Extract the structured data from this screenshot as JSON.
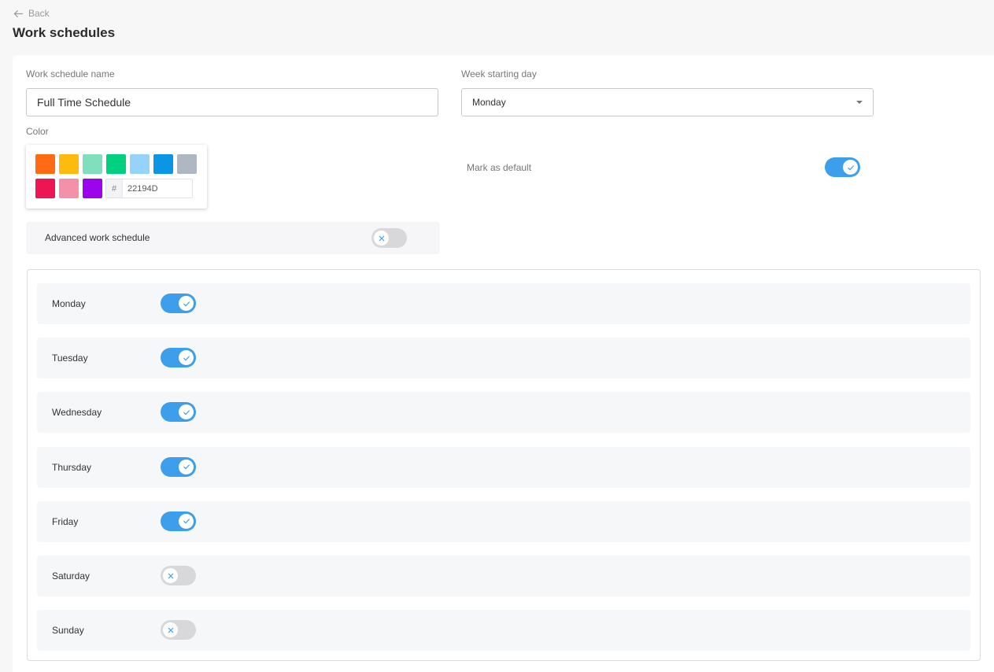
{
  "nav": {
    "back_label": "Back"
  },
  "page": {
    "title": "Work schedules"
  },
  "form": {
    "name_label": "Work schedule name",
    "name_value": "Full Time Schedule",
    "week_start_label": "Week starting day",
    "week_start_value": "Monday",
    "color_label": "Color",
    "colors": [
      "#ff6b12",
      "#fdbb10",
      "#80dfbc",
      "#00d07f",
      "#96d3fa",
      "#0a95e5",
      "#aeb7c2",
      "#ee1554",
      "#f590ab",
      "#9b04ec"
    ],
    "hex_prefix": "#",
    "hex_value": "22194D",
    "mark_default_label": "Mark as default",
    "mark_default_on": true,
    "advanced_label": "Advanced work schedule",
    "advanced_on": false
  },
  "days": [
    {
      "label": "Monday",
      "on": true
    },
    {
      "label": "Tuesday",
      "on": true
    },
    {
      "label": "Wednesday",
      "on": true
    },
    {
      "label": "Thursday",
      "on": true
    },
    {
      "label": "Friday",
      "on": true
    },
    {
      "label": "Saturday",
      "on": false
    },
    {
      "label": "Sunday",
      "on": false
    }
  ],
  "icons": {
    "back": "arrow-left-icon",
    "toggle_on": "check-icon",
    "toggle_off": "x-icon",
    "select": "caret-down-icon"
  },
  "colors": {
    "accent": "#3d9fec",
    "toggle_off": "#d8d8db",
    "row_bg": "#f6f7f9"
  }
}
